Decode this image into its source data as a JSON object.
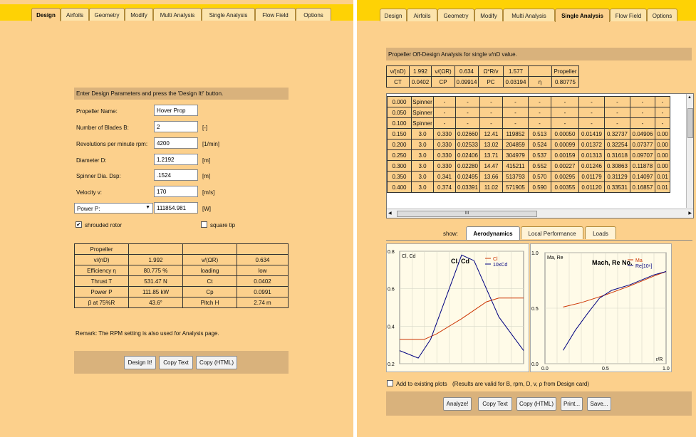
{
  "tabs": [
    "Design",
    "Airfoils",
    "Geometry",
    "Modify",
    "Multi Analysis",
    "Single Analysis",
    "Flow Field",
    "Options"
  ],
  "left": {
    "active_tab": "Design",
    "header": "Enter Design Parameters and press the 'Design It!' button.",
    "fields": [
      {
        "label": "Propeller Name:",
        "value": "Hover Prop",
        "unit": ""
      },
      {
        "label": "Number of Blades  B:",
        "value": "2",
        "unit": "[-]"
      },
      {
        "label": "Revolutions per minute  rpm:",
        "value": "4200",
        "unit": "[1/min]"
      },
      {
        "label": "Diameter  D:",
        "value": "1.2192",
        "unit": "[m]"
      },
      {
        "label": "Spinner Dia.  Dsp:",
        "value": ".1524",
        "unit": "[m]"
      },
      {
        "label": "Velocity  v:",
        "value": "170",
        "unit": "[m/s]"
      }
    ],
    "power_select": "Power  P:",
    "power_value": "111854.981",
    "power_unit": "[W]",
    "shrouded_label": "shrouded rotor",
    "square_tip_label": "square tip",
    "results_header": "Propeller",
    "results": [
      [
        "v/(nD)",
        "1.992",
        "v/(ΩR)",
        "0.634"
      ],
      [
        "Efficiency η",
        "80.775 %",
        "loading",
        "low"
      ],
      [
        "Thrust  T",
        "531.47 N",
        "Ct",
        "0.0402"
      ],
      [
        "Power  P",
        "111.85 kW",
        "Cp",
        "0.0991"
      ],
      [
        "β at 75%R",
        "43.6°",
        "Pitch H",
        "2.74 m"
      ]
    ],
    "remark": "Remark: The RPM setting is also used for Analysis page.",
    "buttons": [
      "Design It!",
      "Copy Text",
      "Copy (HTML)"
    ]
  },
  "right": {
    "active_tab": "Single Analysis",
    "header": "Propeller Off-Design Analysis for single v/nD value.",
    "summary": [
      [
        "v/(nD)",
        "1.992",
        "v/(ΩR)",
        "0.634",
        "Ω*R/v",
        "1.577",
        "",
        "Propeller"
      ],
      [
        "CT",
        "0.0402",
        "CP",
        "0.09914",
        "PC",
        "0.03194",
        "η",
        "0.80775"
      ]
    ],
    "rows": [
      [
        "0.000",
        "Spinner",
        "-",
        "-",
        "-",
        "-",
        "-",
        "-",
        "-",
        "-",
        "-",
        "-"
      ],
      [
        "0.050",
        "Spinner",
        "-",
        "-",
        "-",
        "-",
        "-",
        "-",
        "-",
        "-",
        "-",
        "-"
      ],
      [
        "0.100",
        "Spinner",
        "-",
        "-",
        "-",
        "-",
        "-",
        "-",
        "-",
        "-",
        "-",
        "-"
      ],
      [
        "0.150",
        "3.0",
        "0.330",
        "0.02660",
        "12.41",
        "119852",
        "0.513",
        "0.00050",
        "0.01419",
        "0.32737",
        "0.04906",
        "0.00"
      ],
      [
        "0.200",
        "3.0",
        "0.330",
        "0.02533",
        "13.02",
        "204859",
        "0.524",
        "0.00099",
        "0.01372",
        "0.32254",
        "0.07377",
        "0.00"
      ],
      [
        "0.250",
        "3.0",
        "0.330",
        "0.02406",
        "13.71",
        "304979",
        "0.537",
        "0.00159",
        "0.01313",
        "0.31618",
        "0.09707",
        "0.00"
      ],
      [
        "0.300",
        "3.0",
        "0.330",
        "0.02280",
        "14.47",
        "415211",
        "0.552",
        "0.00227",
        "0.01246",
        "0.30863",
        "0.11878",
        "0.00"
      ],
      [
        "0.350",
        "3.0",
        "0.341",
        "0.02495",
        "13.66",
        "513793",
        "0.570",
        "0.00295",
        "0.01179",
        "0.31129",
        "0.14097",
        "0.01"
      ],
      [
        "0.400",
        "3.0",
        "0.374",
        "0.03391",
        "11.02",
        "571905",
        "0.590",
        "0.00355",
        "0.01120",
        "0.33531",
        "0.16857",
        "0.01"
      ]
    ],
    "scroll_mark": "III",
    "show_label": "show:",
    "show_tabs": [
      "Aerodynamics",
      "Local Performance",
      "Loads"
    ],
    "add_plots_label": "Add to existing plots",
    "validity_note": "(Results are valid for B, rpm, D, v, ρ  from Design card)",
    "buttons": [
      "Analyze!",
      "Copy Text",
      "Copy (HTML)",
      "Print...",
      "Save..."
    ]
  },
  "chart_data": [
    {
      "type": "line",
      "title": "Cl, Cd",
      "ylabel": "Cl, Cd",
      "ylim": [
        0.2,
        0.8
      ],
      "yticks": [
        "0.8",
        "0.6",
        "0.4",
        "0.2"
      ],
      "series": [
        {
          "name": "Cl",
          "color": "#cc3300",
          "points": [
            [
              0.0,
              0.33
            ],
            [
              0.2,
              0.33
            ],
            [
              0.3,
              0.36
            ],
            [
              0.5,
              0.44
            ],
            [
              0.7,
              0.53
            ],
            [
              0.8,
              0.55
            ],
            [
              1.0,
              0.55
            ]
          ]
        },
        {
          "name": "10xCd",
          "color": "#000080",
          "points": [
            [
              0.0,
              0.27
            ],
            [
              0.15,
              0.23
            ],
            [
              0.25,
              0.33
            ],
            [
              0.5,
              0.78
            ],
            [
              0.6,
              0.75
            ],
            [
              0.8,
              0.45
            ],
            [
              1.0,
              0.27
            ]
          ]
        }
      ]
    },
    {
      "type": "line",
      "title": "Mach, Re No.",
      "ylabel": "Ma, Re",
      "xlabel": "r/R",
      "xlim": [
        0.0,
        1.0
      ],
      "ylim": [
        0.0,
        1.0
      ],
      "xticks": [
        "0.0",
        "0.5",
        "1.0"
      ],
      "yticks": [
        "1.0",
        "0.5",
        "0.0"
      ],
      "series": [
        {
          "name": "Ma",
          "color": "#cc3300",
          "points": [
            [
              0.15,
              0.51
            ],
            [
              0.3,
              0.55
            ],
            [
              0.5,
              0.62
            ],
            [
              0.7,
              0.7
            ],
            [
              0.9,
              0.79
            ],
            [
              1.0,
              0.83
            ]
          ]
        },
        {
          "name": "Re[10⁶]",
          "color": "#000080",
          "points": [
            [
              0.15,
              0.12
            ],
            [
              0.25,
              0.3
            ],
            [
              0.35,
              0.45
            ],
            [
              0.45,
              0.59
            ],
            [
              0.55,
              0.66
            ],
            [
              0.7,
              0.71
            ],
            [
              0.9,
              0.8
            ],
            [
              1.0,
              0.83
            ]
          ]
        }
      ]
    }
  ]
}
